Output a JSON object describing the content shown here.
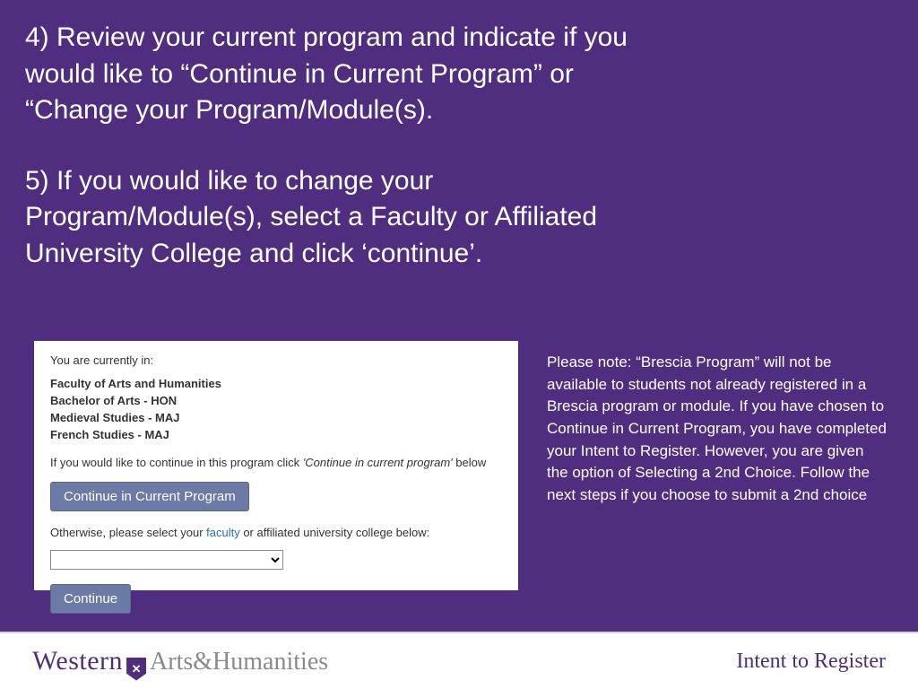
{
  "instructions": {
    "step4": "4) Review your current program and indicate if you would like to “Continue in Current Program” or “Change your Program/Module(s).",
    "step5": "5) If you would like to change your Program/Module(s), select a Faculty or Affiliated University College and click ‘continue’."
  },
  "sidenote": "Please note: “Brescia Program” will not be available to students not already registered in a Brescia program or module. If you have chosen to Continue in Current Program, you have completed your Intent to Register. However, you are given the option of Selecting a 2nd Choice. Follow the next steps if you choose to submit a 2nd choice",
  "panel": {
    "lead": "You are currently in:",
    "program": {
      "line1": "Faculty of Arts and Humanities",
      "line2": "Bachelor of Arts - HON",
      "line3": "Medieval Studies - MAJ",
      "line4": "French Studies - MAJ"
    },
    "continue_hint_pre": "If you would like to continue in this program click ",
    "continue_hint_ital": "'Continue in current program'",
    "continue_hint_post": " below",
    "continue_button": "Continue in Current Program",
    "otherwise_pre": "Otherwise, please select your ",
    "otherwise_link": "faculty",
    "otherwise_post": " or affiliated university college below:",
    "faculty_value": "",
    "continue2_button": "Continue"
  },
  "footer": {
    "logo_western": "Western",
    "logo_dept": "Arts&Humanities",
    "right": "Intent to Register"
  }
}
